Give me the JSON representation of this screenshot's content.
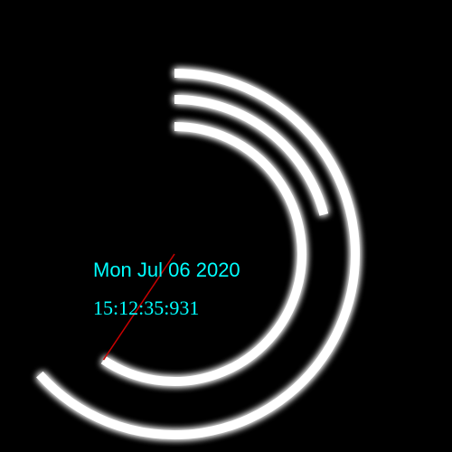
{
  "clock": {
    "date": "Mon Jul 06 2020",
    "time": "15:12:35:931",
    "hours_fraction": 0.634,
    "minutes_fraction": 0.209,
    "seconds_fraction": 0.594,
    "ms_fraction": 0.931
  },
  "colors": {
    "background": "#000000",
    "arc": "#ffffff",
    "glow": "#00e5e5",
    "text": "#00ffff",
    "hand": "#cc0000"
  }
}
